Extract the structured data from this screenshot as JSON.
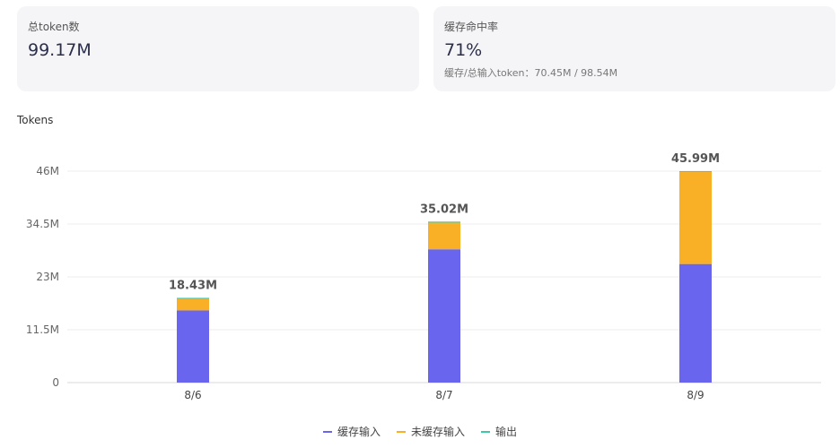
{
  "cards": {
    "total": {
      "label": "总token数",
      "value": "99.17M"
    },
    "cache": {
      "label": "缓存命中率",
      "value": "71%",
      "sub": "缓存/总输入token：70.45M / 98.54M"
    }
  },
  "chart_data": {
    "type": "bar",
    "stacked": true,
    "title": "Tokens",
    "xlabel": "",
    "ylabel": "",
    "categories": [
      "8/6",
      "8/7",
      "8/9"
    ],
    "series": [
      {
        "name": "缓存输入",
        "color": "#6965ee",
        "values": [
          15.7,
          29.0,
          25.8
        ]
      },
      {
        "name": "未缓存输入",
        "color": "#f9b027",
        "values": [
          2.5,
          5.8,
          20.0
        ]
      },
      {
        "name": "输出",
        "color": "#3dc8a7",
        "values": [
          0.23,
          0.22,
          0.19
        ]
      }
    ],
    "totals_labels": [
      "18.43M",
      "35.02M",
      "45.99M"
    ],
    "yticks": [
      0,
      11.5,
      23,
      34.5,
      46
    ],
    "ytick_labels": [
      "0",
      "11.5M",
      "23M",
      "34.5M",
      "46M"
    ],
    "ylim": [
      0,
      46
    ],
    "grid": true,
    "legend_position": "bottom"
  }
}
